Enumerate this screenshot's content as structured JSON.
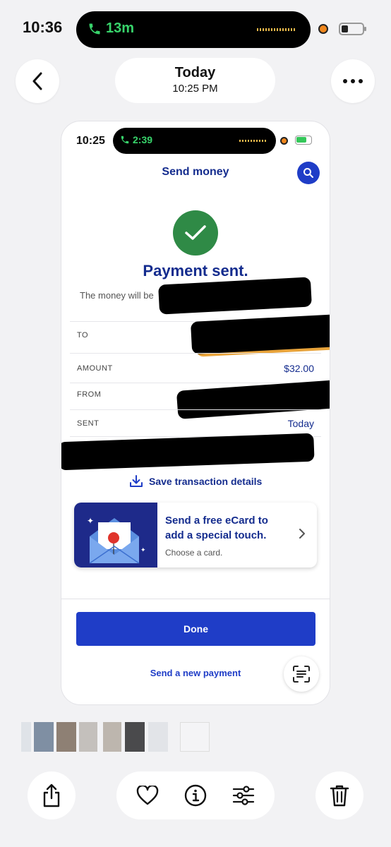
{
  "status_bar": {
    "time": "10:36",
    "call_duration": "13m"
  },
  "header": {
    "date": "Today",
    "time": "10:25 PM"
  },
  "inner": {
    "status_bar": {
      "time": "10:25",
      "call_duration": "2:39"
    },
    "title": "Send money",
    "headline": "Payment sent.",
    "subtext": "The money will be",
    "rows": [
      {
        "label": "TO",
        "value": ""
      },
      {
        "label": "AMOUNT",
        "value": "$32.00"
      },
      {
        "label": "FROM",
        "value": ""
      },
      {
        "label": "SENT",
        "value": "Today"
      }
    ],
    "save_link": "Save transaction details",
    "ecard": {
      "title": "Send a free eCard to add a special touch.",
      "subtitle": "Choose a card."
    },
    "done_label": "Done",
    "new_payment_label": "Send a new payment"
  },
  "colors": {
    "accent": "#1f3dc7",
    "heading": "#142c8e",
    "success": "#2f8a46",
    "call_green": "#38d46b"
  },
  "icons": [
    "back-chevron-icon",
    "more-icon",
    "phone-icon",
    "search-icon",
    "checkmark-icon",
    "download-icon",
    "envelope-icon",
    "chevron-right-icon",
    "text-scan-icon",
    "share-icon",
    "heart-icon",
    "info-icon",
    "adjust-icon",
    "trash-icon"
  ]
}
